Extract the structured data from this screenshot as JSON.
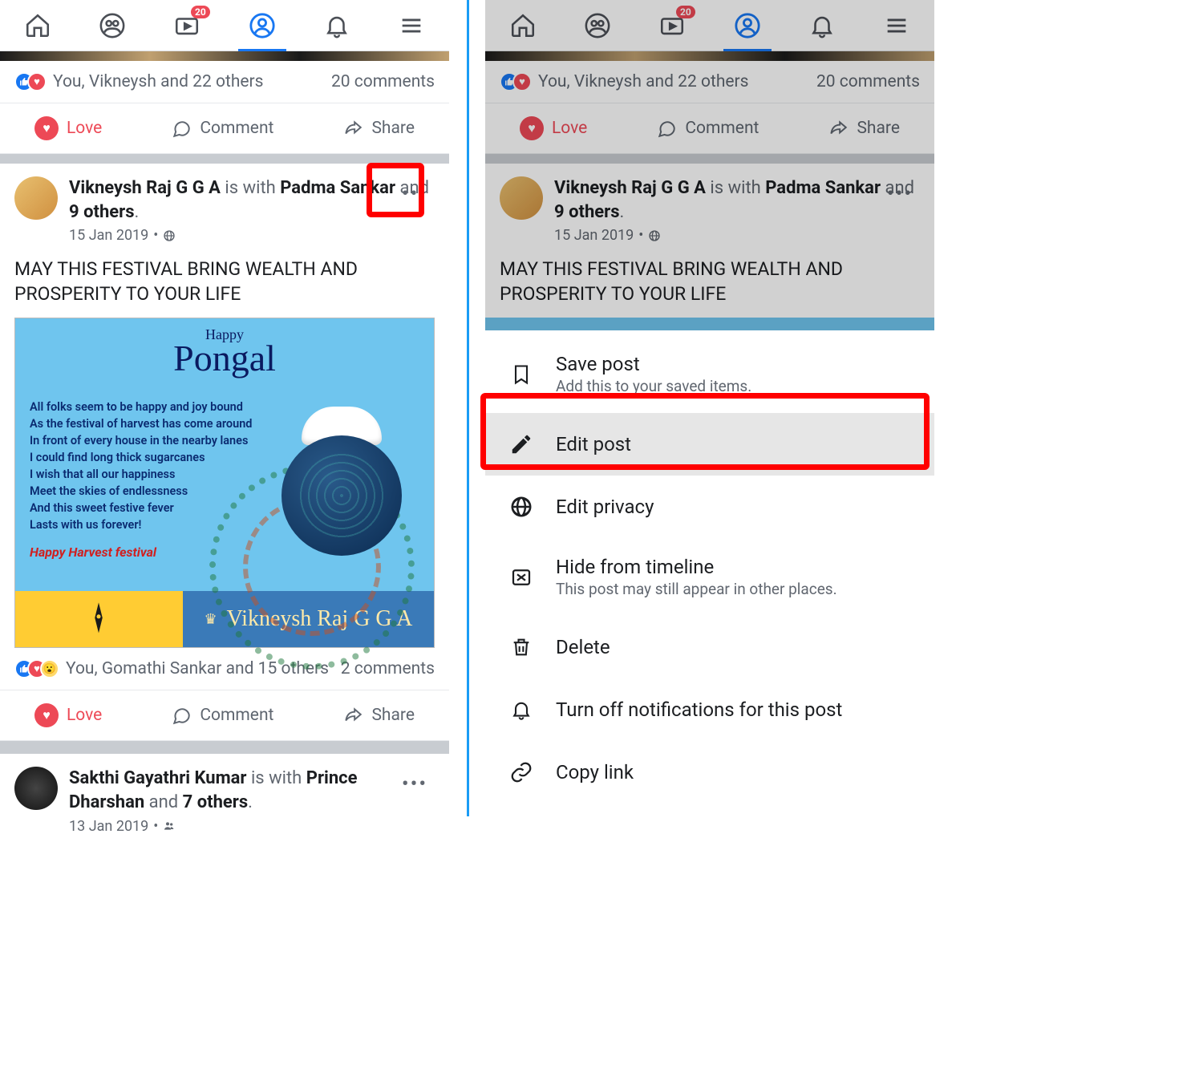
{
  "nav": {
    "badge": "20"
  },
  "post_top": {
    "reactions_text": "You, Vikneysh and 22 others",
    "comments": "20 comments"
  },
  "actions": {
    "love": "Love",
    "comment": "Comment",
    "share": "Share"
  },
  "post1": {
    "author": "Vikneysh Raj G G A",
    "is_with": " is with ",
    "tag1": "Padma Sankar",
    "and": " and ",
    "tag_count": "9 others",
    "date": "15 Jan 2019",
    "text": "MAY THIS FESTIVAL BRING WEALTH AND PROSPERITY TO YOUR LIFE",
    "image": {
      "happy": "Happy",
      "pongal": "Pongal",
      "lines": "All folks seem to be happy and joy bound\nAs the festival of harvest has come around\nIn front of every house in the nearby lanes\nI could find long thick sugarcanes\nI wish that all our happiness\nMeet the skies of endlessness\nAnd this sweet  festive fever\nLasts with us forever!",
      "wish": "Happy Harvest festival",
      "signature": "Vikneysh Raj G G A"
    },
    "reactions_text": "You, Gomathi Sankar and 15 others",
    "comments": "2 comments"
  },
  "post2": {
    "author": "Sakthi Gayathri Kumar",
    "is_with": " is with ",
    "tag1": "Prince Dharshan",
    "and": " and ",
    "tag_count": "7 others",
    "date": "13 Jan 2019"
  },
  "sheet": {
    "save": {
      "title": "Save post",
      "sub": "Add this to your saved items."
    },
    "edit": {
      "title": "Edit post"
    },
    "privacy": {
      "title": "Edit privacy"
    },
    "hide": {
      "title": "Hide from timeline",
      "sub": "This post may still appear in other places."
    },
    "delete": {
      "title": "Delete"
    },
    "noti": {
      "title": "Turn off notifications for this post"
    },
    "copy": {
      "title": "Copy link"
    }
  }
}
